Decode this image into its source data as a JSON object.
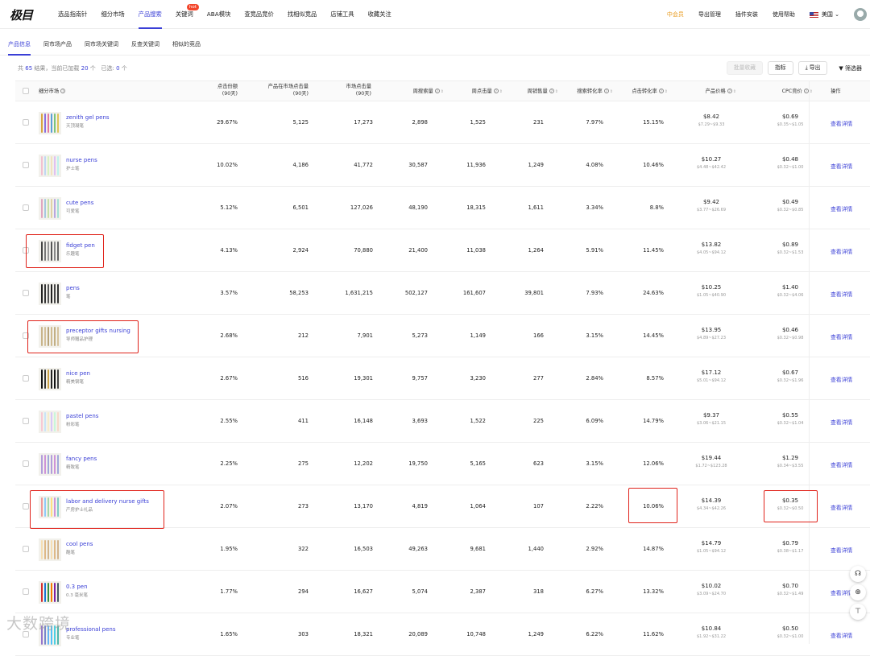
{
  "app": {
    "logo": "极目"
  },
  "nav": [
    "选品指南针",
    "细分市场",
    "产品搜索",
    "关键词",
    "ABA模块",
    "查竞品竞价",
    "找相似竞品",
    "店铺工具",
    "收藏关注"
  ],
  "nav_active": 2,
  "hot_badge": "hot",
  "right_nav": {
    "vip": "中会员",
    "export": "导出管理",
    "plugin": "插件安装",
    "help": "使用帮助",
    "country": "美国"
  },
  "subtabs": [
    "产品信息",
    "同市场产品",
    "同市场关键词",
    "反查关键词",
    "相似的竞品"
  ],
  "summary": {
    "prefix": "共",
    "total": "65",
    "mid": "结果，当前已加载",
    "loaded": "20",
    "unit": "个",
    "selected_label": "已选:",
    "selected": "0",
    "unit2": "个"
  },
  "actions": {
    "collect": "批量收藏",
    "metrics": "指标",
    "export": "导出",
    "filter": "筛选器"
  },
  "columns": {
    "market": "细分市场",
    "click_share": [
      "点击份额",
      "(90天)"
    ],
    "product_clicks": [
      "产品在市场点击量",
      "(90天)"
    ],
    "market_clicks": [
      "市场点击量",
      "(90天)"
    ],
    "weekly_search": "周搜索量",
    "weekly_clicks": "周点击量",
    "weekly_sales": "周销售量",
    "search_conv": "搜索转化率",
    "click_conv": "点击转化率",
    "price": "产品价格",
    "cpc": "CPC竞价",
    "op": "操作"
  },
  "detail_label": "查看详情",
  "rows": [
    {
      "name": "zenith gel pens",
      "sub": "天顶凝笔",
      "share": "29.67%",
      "pclicks": "5,125",
      "mclicks": "17,273",
      "wsearch": "2,898",
      "wclicks": "1,525",
      "wsales": "231",
      "sconv": "7.97%",
      "cconv": "15.15%",
      "price": "$8.42",
      "price_range": "$7.29~$9.33",
      "cpc": "$0.69",
      "cpc_range": "$0.35~$1.05"
    },
    {
      "name": "nurse pens",
      "sub": "护士笔",
      "share": "10.02%",
      "pclicks": "4,186",
      "mclicks": "41,772",
      "wsearch": "30,587",
      "wclicks": "11,936",
      "wsales": "1,249",
      "sconv": "4.08%",
      "cconv": "10.46%",
      "price": "$10.27",
      "price_range": "$4.48~$42.42",
      "cpc": "$0.48",
      "cpc_range": "$0.32~$1.00"
    },
    {
      "name": "cute pens",
      "sub": "可爱笔",
      "share": "5.12%",
      "pclicks": "6,501",
      "mclicks": "127,026",
      "wsearch": "48,190",
      "wclicks": "18,315",
      "wsales": "1,611",
      "sconv": "3.34%",
      "cconv": "8.8%",
      "price": "$9.42",
      "price_range": "$3.77~$26.69",
      "cpc": "$0.49",
      "cpc_range": "$0.32~$0.85"
    },
    {
      "name": "fidget pen",
      "sub": "乐趣笔",
      "share": "4.13%",
      "pclicks": "2,924",
      "mclicks": "70,880",
      "wsearch": "21,400",
      "wclicks": "11,038",
      "wsales": "1,264",
      "sconv": "5.91%",
      "cconv": "11.45%",
      "price": "$13.82",
      "price_range": "$4.05~$94.12",
      "cpc": "$0.89",
      "cpc_range": "$0.32~$1.53"
    },
    {
      "name": "pens",
      "sub": "笔",
      "share": "3.57%",
      "pclicks": "58,253",
      "mclicks": "1,631,215",
      "wsearch": "502,127",
      "wclicks": "161,607",
      "wsales": "39,801",
      "sconv": "7.93%",
      "cconv": "24.63%",
      "price": "$10.25",
      "price_range": "$1.05~$40.90",
      "cpc": "$1.40",
      "cpc_range": "$0.32~$4.06"
    },
    {
      "name": "preceptor gifts nursing",
      "sub": "导师赠品护理",
      "share": "2.68%",
      "pclicks": "212",
      "mclicks": "7,901",
      "wsearch": "5,273",
      "wclicks": "1,149",
      "wsales": "166",
      "sconv": "3.15%",
      "cconv": "14.45%",
      "price": "$13.95",
      "price_range": "$4.89~$27.23",
      "cpc": "$0.46",
      "cpc_range": "$0.32~$0.98"
    },
    {
      "name": "nice pen",
      "sub": "精美钢笔",
      "share": "2.67%",
      "pclicks": "516",
      "mclicks": "19,301",
      "wsearch": "9,757",
      "wclicks": "3,230",
      "wsales": "277",
      "sconv": "2.84%",
      "cconv": "8.57%",
      "price": "$17.12",
      "price_range": "$5.01~$94.12",
      "cpc": "$0.67",
      "cpc_range": "$0.32~$1.96"
    },
    {
      "name": "pastel pens",
      "sub": "粉彩笔",
      "share": "2.55%",
      "pclicks": "411",
      "mclicks": "16,148",
      "wsearch": "3,693",
      "wclicks": "1,522",
      "wsales": "225",
      "sconv": "6.09%",
      "cconv": "14.79%",
      "price": "$9.37",
      "price_range": "$3.06~$21.15",
      "cpc": "$0.55",
      "cpc_range": "$0.32~$1.04"
    },
    {
      "name": "fancy pens",
      "sub": "精致笔",
      "share": "2.25%",
      "pclicks": "275",
      "mclicks": "12,202",
      "wsearch": "19,750",
      "wclicks": "5,165",
      "wsales": "623",
      "sconv": "3.15%",
      "cconv": "12.06%",
      "price": "$19.44",
      "price_range": "$1.72~$123.28",
      "cpc": "$1.29",
      "cpc_range": "$0.34~$3.55"
    },
    {
      "name": "labor and delivery nurse gifts",
      "sub": "产房护士礼品",
      "share": "2.07%",
      "pclicks": "273",
      "mclicks": "13,170",
      "wsearch": "4,819",
      "wclicks": "1,064",
      "wsales": "107",
      "sconv": "2.22%",
      "cconv": "10.06%",
      "price": "$14.39",
      "price_range": "$4.34~$42.26",
      "cpc": "$0.35",
      "cpc_range": "$0.32~$0.50"
    },
    {
      "name": "cool pens",
      "sub": "酷笔",
      "share": "1.95%",
      "pclicks": "322",
      "mclicks": "16,503",
      "wsearch": "49,263",
      "wclicks": "9,681",
      "wsales": "1,440",
      "sconv": "2.92%",
      "cconv": "14.87%",
      "price": "$14.79",
      "price_range": "$1.05~$94.12",
      "cpc": "$0.79",
      "cpc_range": "$0.38~$1.17"
    },
    {
      "name": "0.3 pen",
      "sub": "0.3 毫米笔",
      "share": "1.77%",
      "pclicks": "294",
      "mclicks": "16,627",
      "wsearch": "5,074",
      "wclicks": "2,387",
      "wsales": "318",
      "sconv": "6.27%",
      "cconv": "13.32%",
      "price": "$10.02",
      "price_range": "$3.09~$24.70",
      "cpc": "$0.70",
      "cpc_range": "$0.32~$1.49"
    },
    {
      "name": "professional pens",
      "sub": "专业笔",
      "share": "1.65%",
      "pclicks": "303",
      "mclicks": "18,321",
      "wsearch": "20,089",
      "wclicks": "10,748",
      "wsales": "1,249",
      "sconv": "6.22%",
      "cconv": "11.62%",
      "price": "$10.84",
      "price_range": "$1.92~$31.22",
      "cpc": "$0.50",
      "cpc_range": "$0.32~$1.00"
    }
  ],
  "watermark": "大数跨境"
}
